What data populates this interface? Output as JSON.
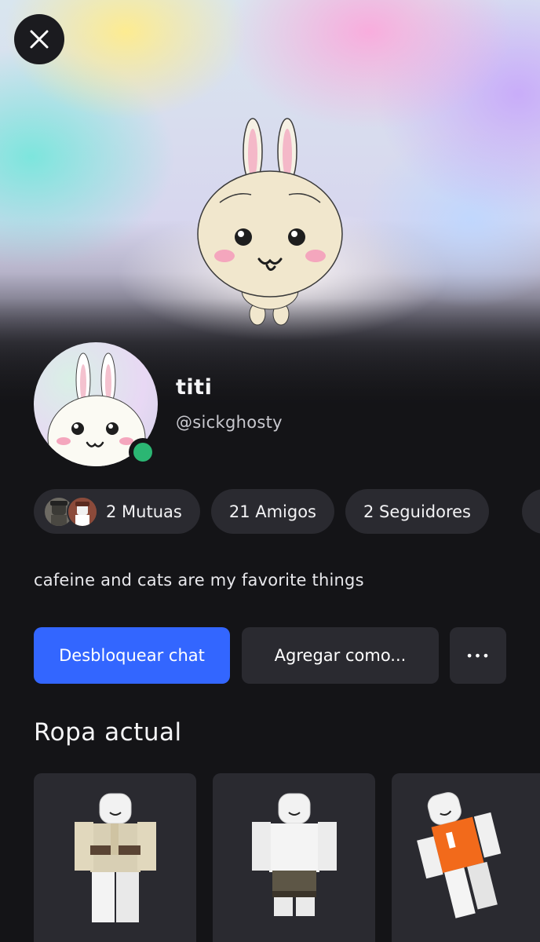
{
  "header": {
    "close_icon": "close-icon"
  },
  "profile": {
    "display_name": "titi",
    "username": "@sickghosty",
    "online_status_color": "#2bb673"
  },
  "stats": [
    {
      "label": "2 Mutuas"
    },
    {
      "label": "21 Amigos"
    },
    {
      "label": "2 Seguidores"
    }
  ],
  "bio": "cafeine and cats are my favorite things",
  "actions": {
    "primary_label": "Desbloquear chat",
    "secondary_label": "Agregar como...",
    "more_label": "•••"
  },
  "outfit": {
    "title": "Ropa actual"
  },
  "colors": {
    "accent": "#3366ff",
    "surface": "#2a2a30",
    "background": "#141417"
  }
}
